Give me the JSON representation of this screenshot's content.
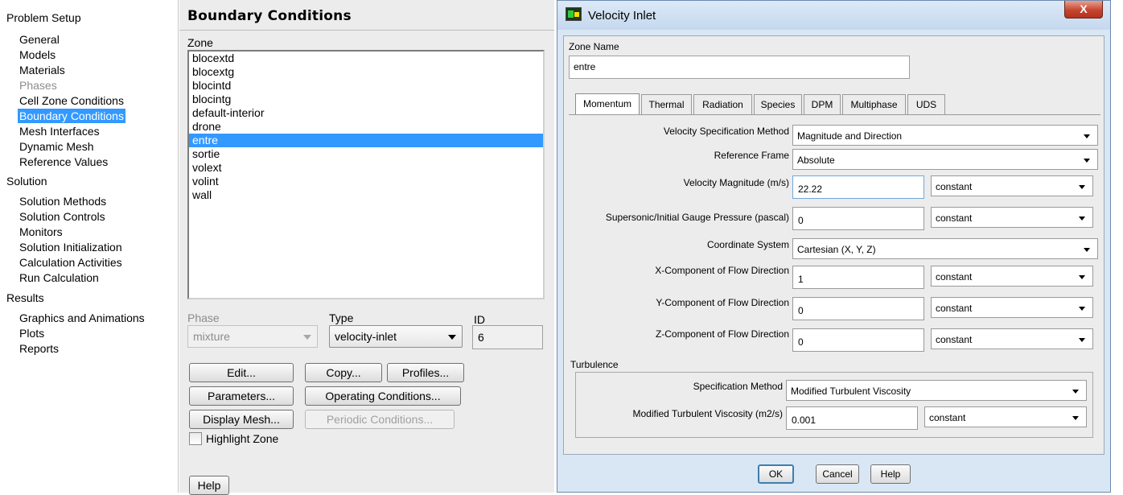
{
  "tree": {
    "sections": [
      {
        "label": "Problem Setup",
        "items": [
          {
            "label": "General",
            "state": "normal"
          },
          {
            "label": "Models",
            "state": "normal"
          },
          {
            "label": "Materials",
            "state": "normal"
          },
          {
            "label": "Phases",
            "state": "disabled"
          },
          {
            "label": "Cell Zone Conditions",
            "state": "normal"
          },
          {
            "label": "Boundary Conditions",
            "state": "selected"
          },
          {
            "label": "Mesh Interfaces",
            "state": "normal"
          },
          {
            "label": "Dynamic Mesh",
            "state": "normal"
          },
          {
            "label": "Reference Values",
            "state": "normal"
          }
        ]
      },
      {
        "label": "Solution",
        "items": [
          {
            "label": "Solution Methods",
            "state": "normal"
          },
          {
            "label": "Solution Controls",
            "state": "normal"
          },
          {
            "label": "Monitors",
            "state": "normal"
          },
          {
            "label": "Solution Initialization",
            "state": "normal"
          },
          {
            "label": "Calculation Activities",
            "state": "normal"
          },
          {
            "label": "Run Calculation",
            "state": "normal"
          }
        ]
      },
      {
        "label": "Results",
        "items": [
          {
            "label": "Graphics and Animations",
            "state": "normal"
          },
          {
            "label": "Plots",
            "state": "normal"
          },
          {
            "label": "Reports",
            "state": "normal"
          }
        ]
      }
    ]
  },
  "boundary": {
    "title": "Boundary Conditions",
    "zone_label": "Zone",
    "zones": [
      "blocextd",
      "blocextg",
      "blocintd",
      "blocintg",
      "default-interior",
      "drone",
      "entre",
      "sortie",
      "volext",
      "volint",
      "wall"
    ],
    "selected_zone": "entre",
    "phase_label": "Phase",
    "phase_value": "mixture",
    "type_label": "Type",
    "type_value": "velocity-inlet",
    "id_label": "ID",
    "id_value": "6",
    "buttons": {
      "edit": "Edit...",
      "copy": "Copy...",
      "profiles": "Profiles...",
      "parameters": "Parameters...",
      "operating": "Operating Conditions...",
      "display_mesh": "Display Mesh...",
      "periodic": "Periodic Conditions...",
      "help": "Help"
    },
    "highlight_zone_label": "Highlight Zone",
    "highlight_zone_checked": false
  },
  "dialog": {
    "title": "Velocity Inlet",
    "close_glyph": "X",
    "zone_name_label": "Zone Name",
    "zone_name_value": "entre",
    "tabs": [
      "Momentum",
      "Thermal",
      "Radiation",
      "Species",
      "DPM",
      "Multiphase",
      "UDS"
    ],
    "active_tab": "Momentum",
    "momentum": {
      "velocity_spec_label": "Velocity Specification Method",
      "velocity_spec_value": "Magnitude and Direction",
      "reference_frame_label": "Reference Frame",
      "reference_frame_value": "Absolute",
      "velocity_magnitude_label": "Velocity Magnitude (m/s)",
      "velocity_magnitude_value": "22.22",
      "velocity_magnitude_profile": "constant",
      "pressure_label": "Supersonic/Initial Gauge Pressure (pascal)",
      "pressure_value": "0",
      "pressure_profile": "constant",
      "coord_system_label": "Coordinate System",
      "coord_system_value": "Cartesian (X, Y, Z)",
      "x_dir_label": "X-Component of Flow Direction",
      "x_dir_value": "1",
      "x_dir_profile": "constant",
      "y_dir_label": "Y-Component of Flow Direction",
      "y_dir_value": "0",
      "y_dir_profile": "constant",
      "z_dir_label": "Z-Component of Flow Direction",
      "z_dir_value": "0",
      "z_dir_profile": "constant"
    },
    "turbulence": {
      "group_label": "Turbulence",
      "spec_label": "Specification Method",
      "spec_value": "Modified Turbulent Viscosity",
      "viscosity_label": "Modified Turbulent Viscosity (m2/s)",
      "viscosity_value": "0.001",
      "viscosity_profile": "constant"
    },
    "buttons": {
      "ok": "OK",
      "cancel": "Cancel",
      "help": "Help"
    }
  },
  "colors": {
    "selection": "#3399ff",
    "dialog_frame": "#d9e7f5",
    "close_button": "#c6452f"
  }
}
